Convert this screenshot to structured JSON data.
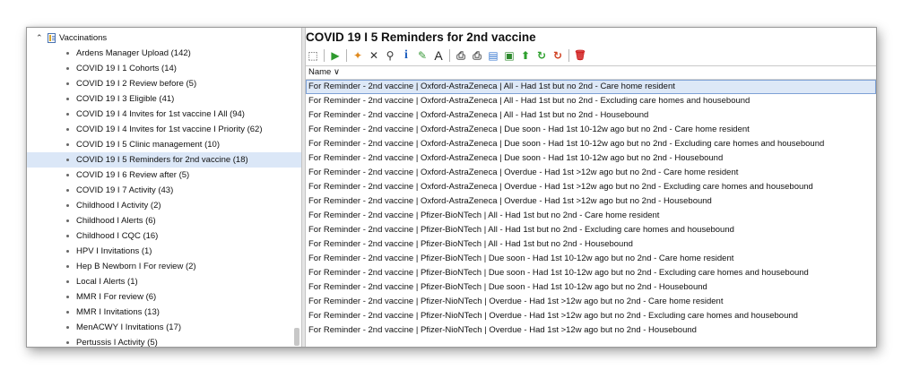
{
  "tree": {
    "root_label": "Vaccinations",
    "items": [
      {
        "label": "Ardens Manager Upload (142)"
      },
      {
        "label": "COVID 19 I 1 Cohorts (14)"
      },
      {
        "label": "COVID 19 I 2 Review before (5)"
      },
      {
        "label": "COVID 19 I 3 Eligible (41)"
      },
      {
        "label": "COVID 19 I 4 Invites for 1st vaccine I All (94)"
      },
      {
        "label": "COVID 19 I 4 Invites for 1st vaccine I Priority (62)"
      },
      {
        "label": "COVID 19 I 5 Clinic management (10)"
      },
      {
        "label": "COVID 19 I 5 Reminders for 2nd vaccine (18)",
        "selected": true
      },
      {
        "label": "COVID 19 I 6 Review after (5)"
      },
      {
        "label": "COVID 19 I 7 Activity (43)"
      },
      {
        "label": "Childhood I Activity (2)"
      },
      {
        "label": "Childhood I Alerts (6)"
      },
      {
        "label": "Childhood I CQC (16)"
      },
      {
        "label": "HPV I Invitations (1)"
      },
      {
        "label": "Hep B Newborn I For review (2)"
      },
      {
        "label": "Local I Alerts (1)"
      },
      {
        "label": "MMR I For review (6)"
      },
      {
        "label": "MMR I Invitations (13)"
      },
      {
        "label": "MenACWY I Invitations (17)"
      },
      {
        "label": "Pertussis I Activity (5)"
      }
    ]
  },
  "main": {
    "title": "COVID 19 I 5 Reminders for 2nd vaccine",
    "column_header": "Name ∨",
    "rows": [
      {
        "text": "For Reminder - 2nd vaccine | Oxford-AstraZeneca | All - Had 1st but no 2nd - Care home resident",
        "selected": true
      },
      {
        "text": "For Reminder - 2nd vaccine | Oxford-AstraZeneca | All - Had 1st but no 2nd - Excluding care homes and housebound"
      },
      {
        "text": "For Reminder - 2nd vaccine | Oxford-AstraZeneca | All - Had 1st but no 2nd - Housebound"
      },
      {
        "text": "For Reminder - 2nd vaccine | Oxford-AstraZeneca | Due soon - Had 1st 10-12w ago but no 2nd - Care home resident"
      },
      {
        "text": "For Reminder - 2nd vaccine | Oxford-AstraZeneca | Due soon - Had 1st 10-12w ago but no 2nd - Excluding care homes and housebound"
      },
      {
        "text": "For Reminder - 2nd vaccine | Oxford-AstraZeneca | Due soon - Had 1st 10-12w ago but no 2nd - Housebound"
      },
      {
        "text": "For Reminder - 2nd vaccine | Oxford-AstraZeneca | Overdue - Had 1st >12w ago but no 2nd - Care home resident"
      },
      {
        "text": "For Reminder - 2nd vaccine | Oxford-AstraZeneca | Overdue - Had 1st >12w ago but no 2nd - Excluding care homes and housebound"
      },
      {
        "text": "For Reminder - 2nd vaccine | Oxford-AstraZeneca | Overdue - Had 1st >12w ago but no 2nd - Housebound"
      },
      {
        "text": "For Reminder - 2nd vaccine | Pfizer-BioNTech | All - Had 1st but no 2nd - Care home resident"
      },
      {
        "text": "For Reminder - 2nd vaccine | Pfizer-BioNTech | All - Had 1st but no 2nd - Excluding care homes and housebound"
      },
      {
        "text": "For Reminder - 2nd vaccine | Pfizer-BioNTech | All - Had 1st but no 2nd - Housebound"
      },
      {
        "text": "For Reminder - 2nd vaccine | Pfizer-BioNTech | Due soon - Had 1st 10-12w ago but no 2nd - Care home resident"
      },
      {
        "text": "For Reminder - 2nd vaccine | Pfizer-BioNTech | Due soon - Had 1st 10-12w ago but no 2nd - Excluding care homes and housebound"
      },
      {
        "text": "For Reminder - 2nd vaccine | Pfizer-BioNTech | Due soon - Had 1st 10-12w ago but no 2nd - Housebound"
      },
      {
        "text": "For Reminder - 2nd vaccine | Pfizer-NioNTech | Overdue - Had 1st >12w ago but no 2nd - Care home resident"
      },
      {
        "text": "For Reminder - 2nd vaccine | Pfizer-NioNTech | Overdue - Had 1st >12w ago but no 2nd - Excluding care homes and housebound"
      },
      {
        "text": "For Reminder - 2nd vaccine | Pfizer-NioNTech | Overdue - Had 1st >12w ago but no 2nd - Housebound"
      }
    ]
  },
  "toolbar": {
    "buttons": [
      {
        "icon": "select-all-icon",
        "color": "#444444"
      },
      {
        "sep": true
      },
      {
        "icon": "run-icon",
        "color": "#2e9a2e"
      },
      {
        "sep": true
      },
      {
        "icon": "add-search-icon",
        "color": "#e08a1e"
      },
      {
        "icon": "delete-x-icon",
        "color": "#333333"
      },
      {
        "icon": "search-icon",
        "color": "#333333"
      },
      {
        "icon": "info-icon",
        "color": "#1f5fbf"
      },
      {
        "icon": "edit-pen-icon",
        "color": "#3a9a3a"
      },
      {
        "icon": "rename-icon",
        "color": "#222222"
      },
      {
        "sep": true
      },
      {
        "icon": "print-icon",
        "color": "#555555"
      },
      {
        "icon": "print-list-icon",
        "color": "#555555"
      },
      {
        "icon": "export-icon",
        "color": "#3a7ad0"
      },
      {
        "icon": "report-icon",
        "color": "#2e8a2e"
      },
      {
        "icon": "move-up-icon",
        "color": "#2ea02e"
      },
      {
        "icon": "refresh-icon",
        "color": "#2ea02e"
      },
      {
        "icon": "refresh-all-icon",
        "color": "#d04020"
      },
      {
        "sep": true
      },
      {
        "icon": "trash-icon",
        "color": "#d02020"
      }
    ]
  }
}
